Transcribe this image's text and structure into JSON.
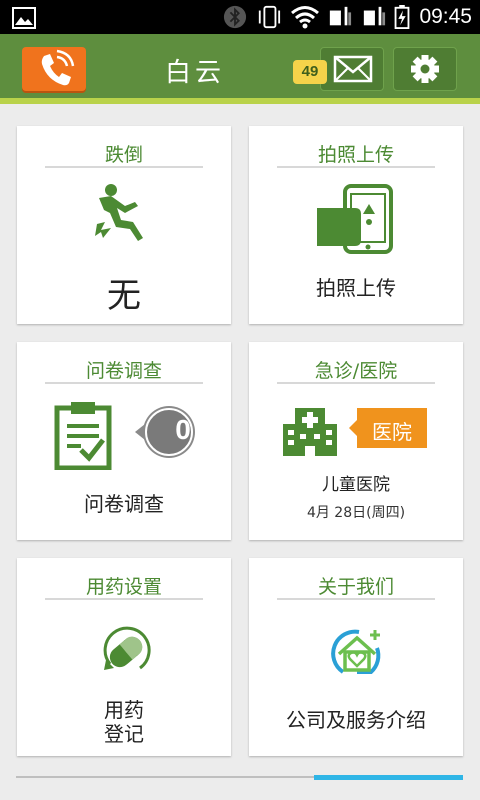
{
  "status_bar": {
    "time": "09:45"
  },
  "header": {
    "title": "白云",
    "mail_badge_count": "49"
  },
  "cards": {
    "fall": {
      "title": "跌倒",
      "value": "无"
    },
    "photo": {
      "title": "拍照上传",
      "label": "拍照上传"
    },
    "survey": {
      "title": "问卷调查",
      "count": "0",
      "label": "问卷调查"
    },
    "emergency": {
      "title": "急诊/医院",
      "tag": "医院",
      "hospital": "儿童医院",
      "date": "4月 28日(周四)"
    },
    "medication": {
      "title": "用药设置",
      "label_line1": "用药",
      "label_line2": "登记"
    },
    "about": {
      "title": "关于我们",
      "label": "公司及服务介绍"
    }
  },
  "colors": {
    "header_green": "#5e8e3e",
    "accent_orange": "#f0731d",
    "icon_green": "#4c8a33",
    "badge_yellow": "#f5d34a"
  }
}
